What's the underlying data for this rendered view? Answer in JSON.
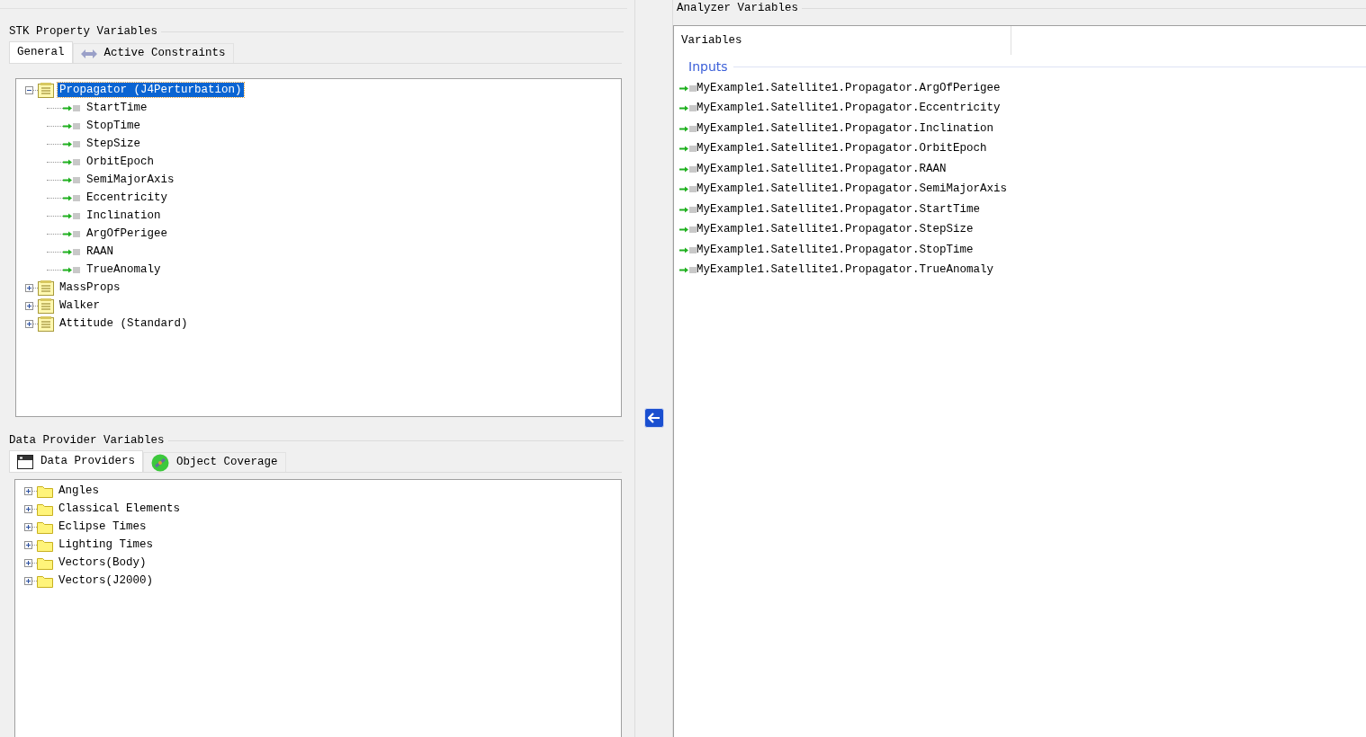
{
  "stk_property_variables": {
    "title": "STK Property Variables",
    "tabs": [
      {
        "label": "General",
        "selected": true,
        "kind": "plain"
      },
      {
        "label": "Active Constraints",
        "selected": false,
        "kind": "constraints"
      }
    ],
    "tree": [
      {
        "label": "Propagator (J4Perturbation)",
        "kind": "group",
        "expanded": true,
        "selected": true,
        "children": [
          {
            "label": "StartTime",
            "kind": "variable",
            "selected": false
          },
          {
            "label": "StopTime",
            "kind": "variable",
            "selected": false
          },
          {
            "label": "StepSize",
            "kind": "variable",
            "selected": false
          },
          {
            "label": "OrbitEpoch",
            "kind": "variable",
            "selected": false
          },
          {
            "label": "SemiMajorAxis",
            "kind": "variable",
            "selected": false
          },
          {
            "label": "Eccentricity",
            "kind": "variable",
            "selected": false
          },
          {
            "label": "Inclination",
            "kind": "variable",
            "selected": false
          },
          {
            "label": "ArgOfPerigee",
            "kind": "variable",
            "selected": false
          },
          {
            "label": "RAAN",
            "kind": "variable",
            "selected": false
          },
          {
            "label": "TrueAnomaly",
            "kind": "variable",
            "selected": false
          }
        ]
      },
      {
        "label": "MassProps",
        "kind": "group",
        "expanded": false,
        "selected": false
      },
      {
        "label": "Walker",
        "kind": "group",
        "expanded": false,
        "selected": false
      },
      {
        "label": "Attitude (Standard)",
        "kind": "group",
        "expanded": false,
        "selected": false
      }
    ]
  },
  "data_provider_variables": {
    "title": "Data Provider Variables",
    "tabs": [
      {
        "label": "Data Providers",
        "selected": true,
        "kind": "providers"
      },
      {
        "label": "Object Coverage",
        "selected": false,
        "kind": "coverage"
      }
    ],
    "tree": [
      {
        "label": "Angles",
        "kind": "folder",
        "expanded": false,
        "selected": false
      },
      {
        "label": "Classical Elements",
        "kind": "folder",
        "expanded": false,
        "selected": false
      },
      {
        "label": "Eclipse Times",
        "kind": "folder",
        "expanded": false,
        "selected": false
      },
      {
        "label": "Lighting Times",
        "kind": "folder",
        "expanded": false,
        "selected": false
      },
      {
        "label": "Vectors(Body)",
        "kind": "folder",
        "expanded": false,
        "selected": false
      },
      {
        "label": "Vectors(J2000)",
        "kind": "folder",
        "expanded": false,
        "selected": false
      }
    ]
  },
  "analyzer_variables": {
    "title": "Analyzer Variables",
    "column": "Variables",
    "group": "Inputs",
    "items": [
      "MyExample1.Satellite1.Propagator.ArgOfPerigee",
      "MyExample1.Satellite1.Propagator.Eccentricity",
      "MyExample1.Satellite1.Propagator.Inclination",
      "MyExample1.Satellite1.Propagator.OrbitEpoch",
      "MyExample1.Satellite1.Propagator.RAAN",
      "MyExample1.Satellite1.Propagator.SemiMajorAxis",
      "MyExample1.Satellite1.Propagator.StartTime",
      "MyExample1.Satellite1.Propagator.StepSize",
      "MyExample1.Satellite1.Propagator.StopTime",
      "MyExample1.Satellite1.Propagator.TrueAnomaly"
    ]
  }
}
